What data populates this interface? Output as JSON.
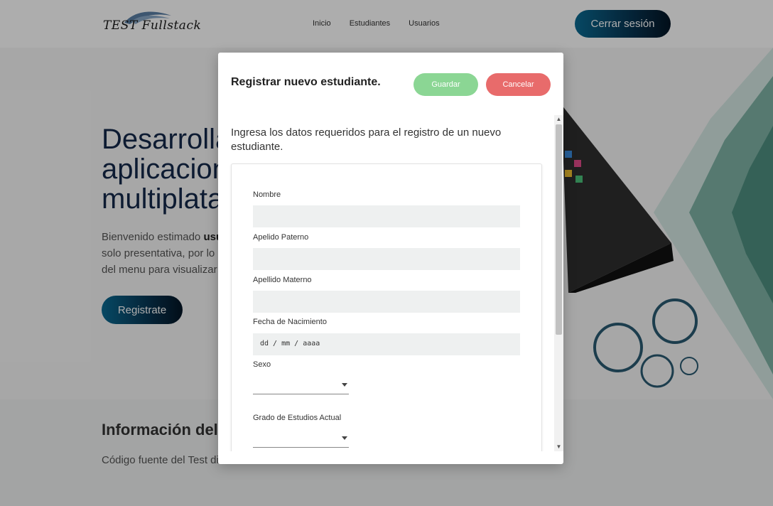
{
  "header": {
    "logo_text": "TEST Fullstack",
    "nav": [
      "Inicio",
      "Estudiantes",
      "Usuarios"
    ],
    "logout_label": "Cerrar sesión"
  },
  "hero": {
    "title": "Desarrolla\naplicacion\nmultiplata",
    "text_a": "Bienvenido estimado ",
    "text_bold": "usu",
    "text_b": "solo presentativa, por lo c",
    "text_c": "del menu para visualizar ",
    "register_label": "Registrate"
  },
  "info": {
    "title": "Información del",
    "text": "Código fuente del Test di"
  },
  "modal": {
    "title": "Registrar nuevo estudiante.",
    "save_label": "Guardar",
    "cancel_label": "Cancelar",
    "intro": "Ingresa los datos requeridos para el registro de un nuevo estudiante.",
    "fields": {
      "nombre": "Nombre",
      "apellido_paterno": "Apelido Paterno",
      "apellido_materno": "Apellido Materno",
      "fecha_nacimiento": "Fecha de Nacimiento",
      "fecha_placeholder": "dd / mm / aaaa",
      "sexo": "Sexo",
      "grado": "Grado de Estudios Actual"
    }
  },
  "colors": {
    "accent_dark": "#073451",
    "save": "#8bd694",
    "cancel": "#e86b6b"
  }
}
